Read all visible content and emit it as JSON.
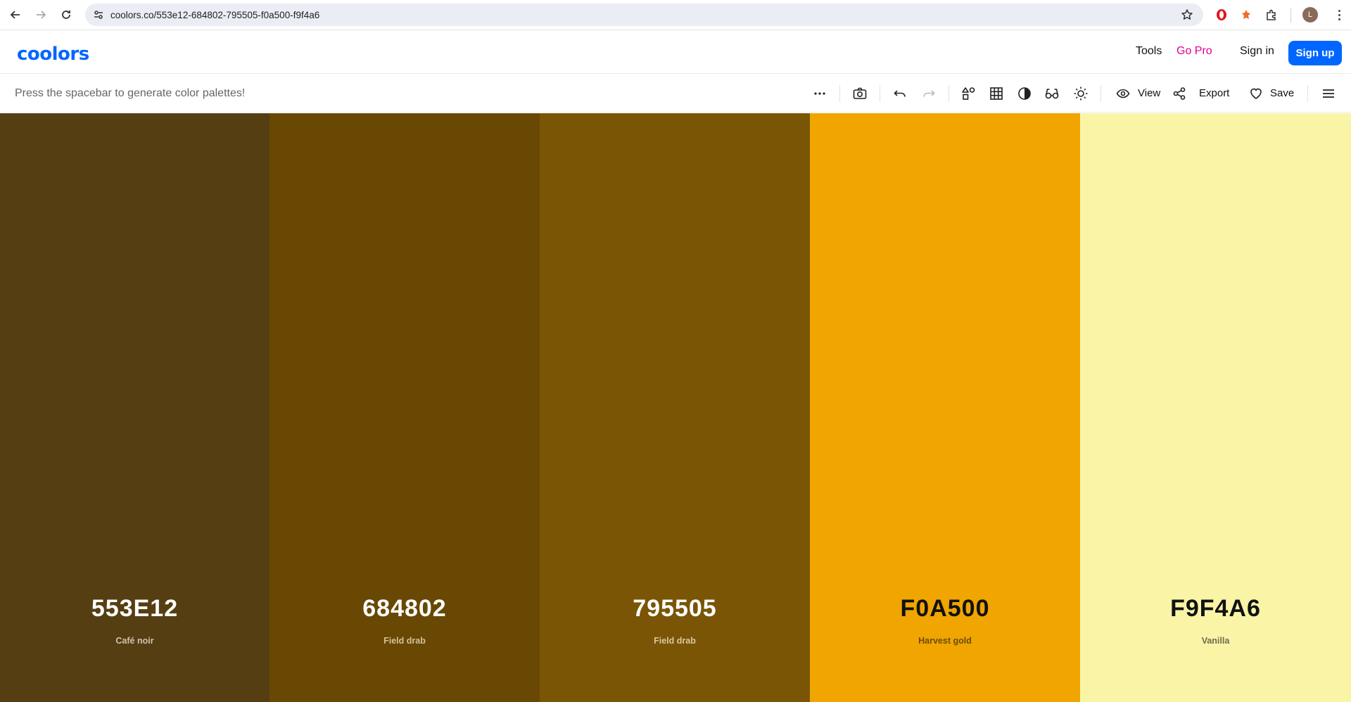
{
  "browser": {
    "url": "coolors.co/553e12-684802-795505-f0a500-f9f4a6",
    "avatar_letter": "L"
  },
  "header": {
    "logo": "coolors",
    "tools": "Tools",
    "go_pro": "Go Pro",
    "sign_in": "Sign in",
    "sign_up": "Sign up"
  },
  "toolbar": {
    "hint": "Press the spacebar to generate color palettes!",
    "view": "View",
    "export": "Export",
    "save": "Save"
  },
  "palette": [
    {
      "hex": "553E12",
      "name": "Café noir",
      "color": "#553e12",
      "text_color": "#ffffff",
      "name_color": "#cfc3ad"
    },
    {
      "hex": "684802",
      "name": "Field drab",
      "color": "#684802",
      "text_color": "#ffffff",
      "name_color": "#d4c29a"
    },
    {
      "hex": "795505",
      "name": "Field drab",
      "color": "#795505",
      "text_color": "#ffffff",
      "name_color": "#dac8a0"
    },
    {
      "hex": "F0A500",
      "name": "Harvest gold",
      "color": "#f0a500",
      "text_color": "#111111",
      "name_color": "#6b4c08"
    },
    {
      "hex": "F9F4A6",
      "name": "Vanilla",
      "color": "#f9f4a6",
      "text_color": "#111111",
      "name_color": "#6f6c4c"
    }
  ]
}
